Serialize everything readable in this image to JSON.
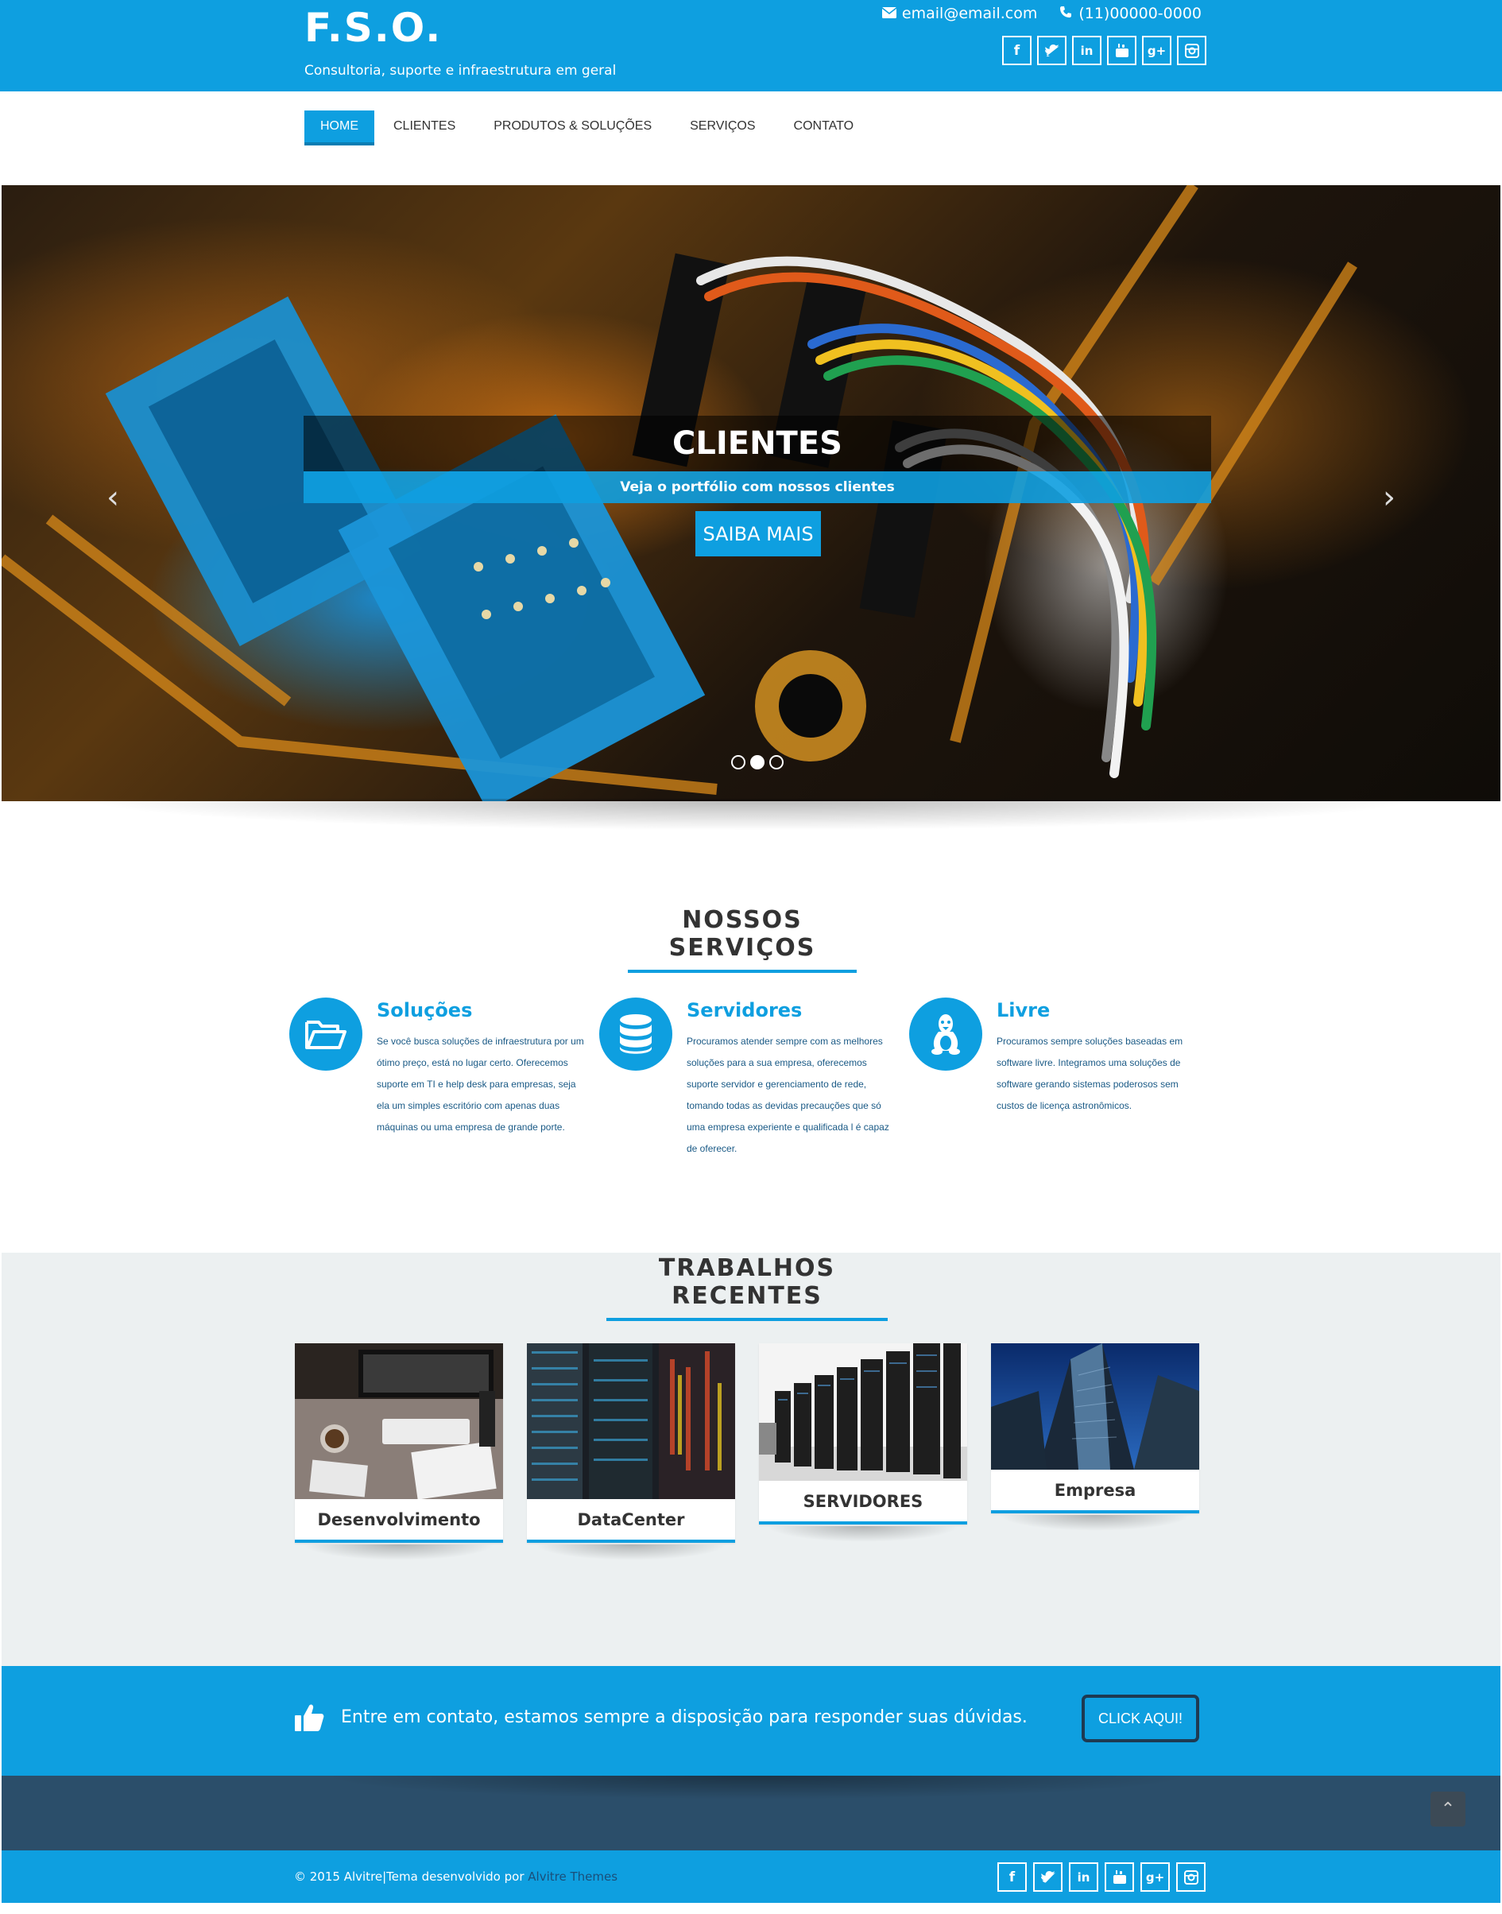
{
  "header": {
    "logo": "F.S.O.",
    "tagline": "Consultoria, suporte e infraestrutura em geral",
    "email": "email@email.com",
    "phone": "(11)00000-0000",
    "social": [
      "f",
      "t",
      "in",
      "yt",
      "g+",
      "ig"
    ]
  },
  "nav": {
    "items": [
      {
        "label": "HOME",
        "active": true
      },
      {
        "label": "CLIENTES"
      },
      {
        "label": "PRODUTOS & SOLUÇÕES"
      },
      {
        "label": "SERVIÇOS"
      },
      {
        "label": "CONTATO"
      }
    ]
  },
  "hero": {
    "title": "CLIENTES",
    "subtitle": "Veja o portfólio com nossos clientes",
    "button": "SAIBA MAIS",
    "prev": "‹",
    "next": "›",
    "slides": 3,
    "active_slide": 2
  },
  "services": {
    "title": "NOSSOS SERVIÇOS",
    "items": [
      {
        "icon": "folder-open-icon",
        "title": "Soluções",
        "text": "Se você busca soluções de infraestrutura por um ótimo preço, está no lugar certo. Oferecemos suporte em TI e help desk para empresas, seja ela um simples escritório com apenas duas máquinas ou uma empresa de grande porte."
      },
      {
        "icon": "database-icon",
        "title": "Servidores",
        "text": "Procuramos atender sempre com as melhores soluções para a sua empresa, oferecemos suporte servidor e gerenciamento de rede, tomando todas as devidas precauções que só uma empresa experiente e qualificada l é capaz de oferecer."
      },
      {
        "icon": "linux-icon",
        "title": "Livre",
        "text": "Procuramos sempre soluções baseadas em software livre. Integramos uma soluções de software gerando sistemas poderosos sem custos de licença astronômicos."
      }
    ]
  },
  "works": {
    "title": "TRABALHOS RECENTES",
    "items": [
      {
        "label": "Desenvolvimento"
      },
      {
        "label": "DataCenter"
      },
      {
        "label": "SERVIDORES"
      },
      {
        "label": "Empresa"
      }
    ]
  },
  "cta": {
    "icon": "thumbs-up-icon",
    "text": "Entre em contato, estamos sempre a disposição para responder suas dúvidas.",
    "button": "CLICK AQUI!"
  },
  "footer": {
    "copyright": "© 2015 Alvitre|Tema desenvolvido por ",
    "link": "Alvitre Themes",
    "to_top": "⌃"
  },
  "colors": {
    "primary": "#0e9fe0",
    "dark_band": "#2b4e6a",
    "works_bg": "#ecf0f1"
  }
}
